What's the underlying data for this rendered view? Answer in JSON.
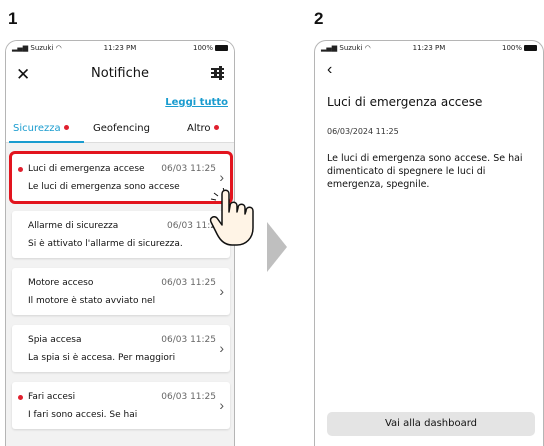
{
  "steps": {
    "one": "1",
    "two": "2"
  },
  "status_bar": {
    "carrier": "Suzuki",
    "time": "11:23 PM",
    "battery": "100%"
  },
  "list_screen": {
    "title": "Notifiche",
    "read_all": "Leggi tutto",
    "tabs": [
      {
        "label": "Sicurezza",
        "active": true,
        "unread": true
      },
      {
        "label": "Geofencing",
        "active": false,
        "unread": false
      },
      {
        "label": "Altro",
        "active": false,
        "unread": true
      }
    ],
    "notifications": [
      {
        "title": "Luci di emergenza accese",
        "date": "06/03 11:25",
        "body": "Le luci di emergenza sono accese",
        "unread": true,
        "highlighted": true
      },
      {
        "title": "Allarme di sicurezza",
        "date": "06/03 11:2",
        "body": "Si è attivato l'allarme di sicurezza.",
        "unread": false,
        "highlighted": false
      },
      {
        "title": "Motore acceso",
        "date": "06/03 11:25",
        "body": "Il motore è stato avviato nel",
        "unread": false,
        "highlighted": false
      },
      {
        "title": "Spia accesa",
        "date": "06/03 11:25",
        "body": "La spia si è accesa. Per maggiori",
        "unread": false,
        "highlighted": false
      },
      {
        "title": "Fari accesi",
        "date": "06/03 11:25",
        "body": "I fari sono accesi. Se hai",
        "unread": true,
        "highlighted": false
      }
    ]
  },
  "detail_screen": {
    "title": "Luci di emergenza accese",
    "date": "06/03/2024 11:25",
    "body": "Le luci di emergenza sono accese. Se hai dimenticato di spegnere le luci di emergenza, spegnile.",
    "dashboard_button": "Vai alla dashboard"
  },
  "colors": {
    "accent": "#1a9ccf",
    "highlight": "#e2141e",
    "unread_dot": "#e0202e"
  }
}
